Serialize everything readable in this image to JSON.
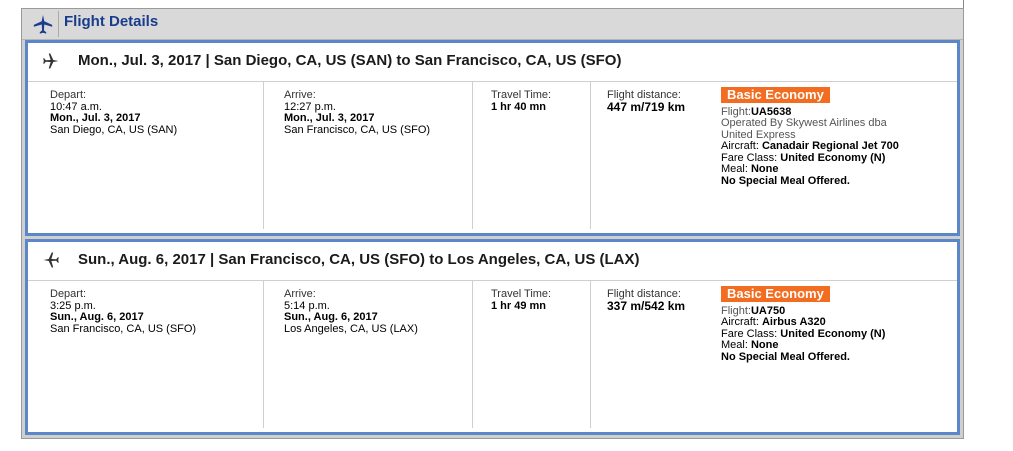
{
  "panel": {
    "title": "Flight Details"
  },
  "segments": [
    {
      "title": "Mon., Jul. 3, 2017 | San Diego, CA, US (SAN) to San Francisco, CA, US (SFO)",
      "depart": {
        "label": "Depart:",
        "time": "10:47 a.m.",
        "date": "Mon., Jul. 3, 2017",
        "place": "San Diego, CA, US (SAN)"
      },
      "arrive": {
        "label": "Arrive:",
        "time": "12:27 p.m.",
        "date": "Mon., Jul. 3, 2017",
        "place": "San Francisco, CA, US (SFO)"
      },
      "travel": {
        "label": "Travel Time:",
        "value": "1 hr 40 mn"
      },
      "distance": {
        "label": "Flight distance:",
        "value": "447 m/719 km"
      },
      "fare": {
        "badge": "Basic Economy",
        "flight_label": "Flight:",
        "flight": "UA5638",
        "operated_1": "Operated By Skywest Airlines dba",
        "operated_2": "United Express",
        "aircraft_label": "Aircraft: ",
        "aircraft": "Canadair Regional Jet 700",
        "class_label": "Fare Class: ",
        "class": "United Economy (N)",
        "meal_label": "Meal: ",
        "meal": "None",
        "special": "No Special Meal Offered."
      }
    },
    {
      "title": "Sun., Aug. 6, 2017 | San Francisco, CA, US (SFO) to Los Angeles, CA, US (LAX)",
      "depart": {
        "label": "Depart:",
        "time": "3:25 p.m.",
        "date": "Sun., Aug. 6, 2017",
        "place": "San Francisco, CA, US (SFO)"
      },
      "arrive": {
        "label": "Arrive:",
        "time": "5:14 p.m.",
        "date": "Sun., Aug. 6, 2017",
        "place": "Los Angeles, CA, US (LAX)"
      },
      "travel": {
        "label": "Travel Time:",
        "value": "1 hr 49 mn"
      },
      "distance": {
        "label": "Flight distance:",
        "value": "337 m/542 km"
      },
      "fare": {
        "badge": "Basic Economy",
        "flight_label": "Flight:",
        "flight": "UA750",
        "aircraft_label": "Aircraft: ",
        "aircraft": "Airbus A320",
        "class_label": "Fare Class: ",
        "class": "United Economy (N)",
        "meal_label": "Meal: ",
        "meal": "None",
        "special": "No Special Meal Offered."
      }
    }
  ],
  "icons": {
    "header": "airplane-icon",
    "departure": "plane-depart-icon",
    "return": "plane-return-icon"
  },
  "colors": {
    "header_text": "#1a3c8c",
    "segment_border": "#5b87c8",
    "badge": "#f26d21"
  }
}
